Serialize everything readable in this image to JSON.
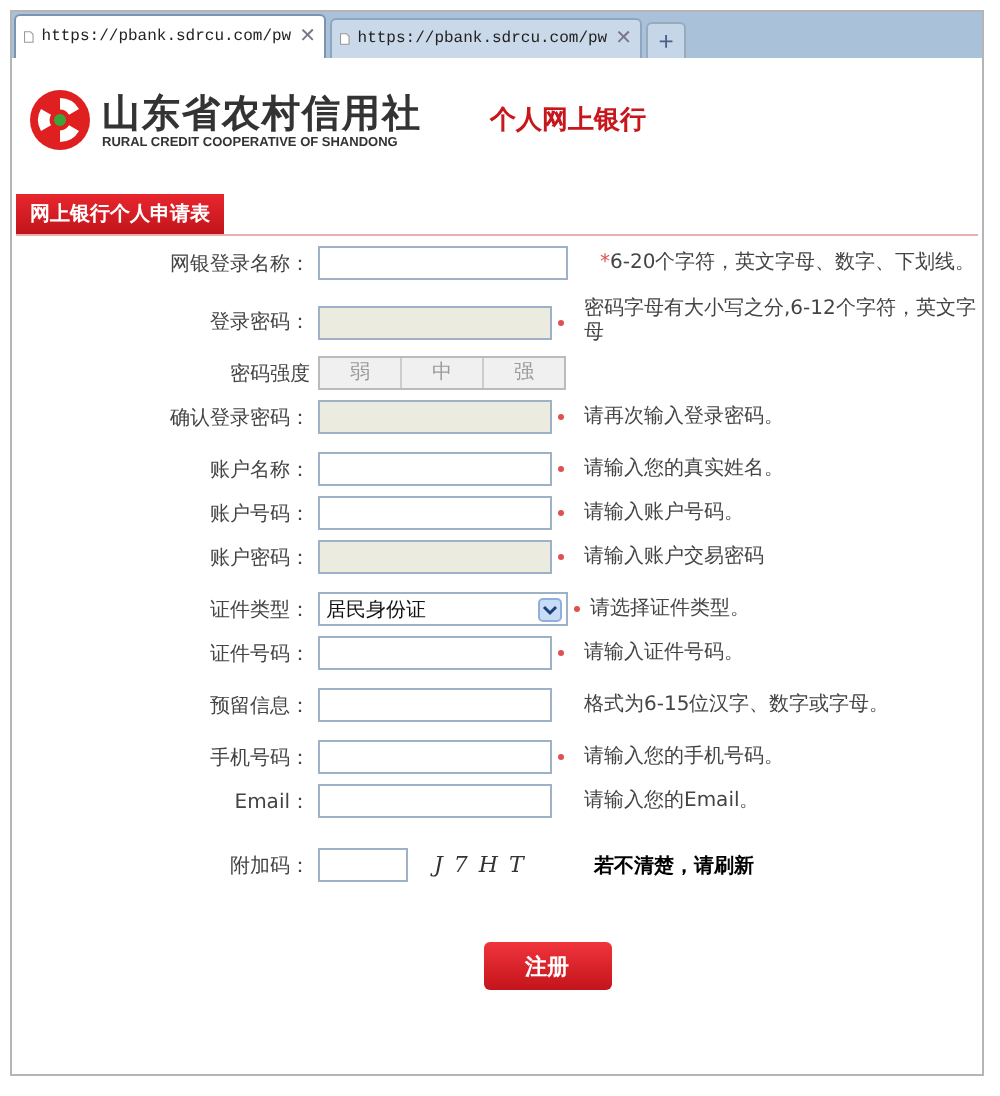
{
  "tabs": [
    {
      "label": "https://pbank.sdrcu.com/pw",
      "selected": true,
      "close": "✕"
    },
    {
      "label": "https://pbank.sdrcu.com/pw",
      "selected": false,
      "close": "✕"
    }
  ],
  "new_tab": "+",
  "header": {
    "org_name": "山东省农村信用社",
    "org_name_en": "RURAL CREDIT COOPERATIVE OF SHANDONG",
    "product": "个人网上银行"
  },
  "form": {
    "title": "网上银行个人申请表",
    "sections": [
      [
        {
          "kind": "text",
          "label": "网银登录名称：",
          "wide": true,
          "required": false,
          "hint_mark": "*",
          "hint": "6-20个字符，英文字母、数字、下划线。"
        }
      ],
      [
        {
          "kind": "password",
          "label": "登录密码：",
          "required": true,
          "hint": "密码字母有大小写之分,6-12个字符，英文字母"
        },
        {
          "kind": "strength",
          "label": "密码强度",
          "levels": [
            "弱",
            "中",
            "强"
          ]
        },
        {
          "kind": "password",
          "label": "确认登录密码：",
          "required": true,
          "hint": "请再次输入登录密码。"
        }
      ],
      [
        {
          "kind": "text",
          "label": "账户名称：",
          "required": true,
          "hint": "请输入您的真实姓名。"
        },
        {
          "kind": "text",
          "label": "账户号码：",
          "required": true,
          "hint": "请输入账户号码。"
        },
        {
          "kind": "password",
          "label": "账户密码：",
          "required": true,
          "hint": "请输入账户交易密码"
        }
      ],
      [
        {
          "kind": "select",
          "label": "证件类型：",
          "value": "居民身份证",
          "required": true,
          "hint": "请选择证件类型。"
        },
        {
          "kind": "text",
          "label": "证件号码：",
          "required": true,
          "hint": "请输入证件号码。"
        }
      ],
      [
        {
          "kind": "text",
          "label": "预留信息：",
          "required": false,
          "hint": "格式为6-15位汉字、数字或字母。"
        }
      ],
      [
        {
          "kind": "text",
          "label": "手机号码：",
          "required": true,
          "hint": "请输入您的手机号码。"
        },
        {
          "kind": "text",
          "label": "Email：",
          "required": false,
          "hint": "请输入您的Email。"
        }
      ],
      [
        {
          "kind": "captcha",
          "label": "附加码：",
          "captcha": "J 7 H T",
          "refresh": "若不清楚，请刷新"
        }
      ]
    ],
    "submit": "注册"
  }
}
